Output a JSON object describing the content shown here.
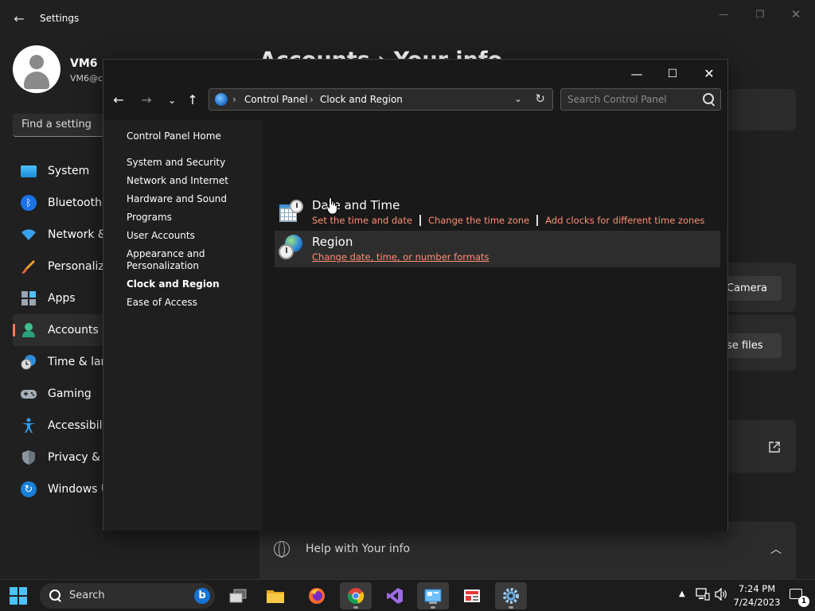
{
  "settings": {
    "window_title": "Settings",
    "user": {
      "name": "VM6",
      "email": "VM6@c"
    },
    "search_placeholder": "Find a setting",
    "nav": [
      {
        "label": "System",
        "icon": "monitor-icon"
      },
      {
        "label": "Bluetooth &",
        "icon": "bluetooth-icon"
      },
      {
        "label": "Network &",
        "icon": "wifi-icon"
      },
      {
        "label": "Personaliza",
        "icon": "brush-icon"
      },
      {
        "label": "Apps",
        "icon": "apps-icon"
      },
      {
        "label": "Accounts",
        "icon": "person-icon",
        "active": true
      },
      {
        "label": "Time & lang",
        "icon": "clock-globe-icon"
      },
      {
        "label": "Gaming",
        "icon": "gamepad-icon"
      },
      {
        "label": "Accessibilit",
        "icon": "accessibility-icon"
      },
      {
        "label": "Privacy & se",
        "icon": "shield-icon"
      },
      {
        "label": "Windows U",
        "icon": "update-icon"
      }
    ],
    "heading": "Accounts  ›  Your info",
    "camera_button": "Camera",
    "files_button": "se files",
    "help_label": "Help with Your info"
  },
  "control_panel": {
    "breadcrumb": [
      "Control Panel",
      "Clock and Region"
    ],
    "search_placeholder": "Search Control Panel",
    "sidebar": [
      "Control Panel Home",
      "System and Security",
      "Network and Internet",
      "Hardware and Sound",
      "Programs",
      "User Accounts",
      "Appearance and Personalization",
      "Clock and Region",
      "Ease of Access"
    ],
    "categories": {
      "date_time": {
        "title": "Date and Time",
        "links": [
          "Set the time and date",
          "Change the time zone",
          "Add clocks for different time zones"
        ]
      },
      "region": {
        "title": "Region",
        "links": [
          "Change date, time, or number formats"
        ]
      }
    }
  },
  "taskbar": {
    "search_label": "Search",
    "time": "7:24 PM",
    "date": "7/24/2023",
    "notification_count": "1",
    "accent_color": "#4cc2ff"
  },
  "colors": {
    "link": "#ff8f73",
    "accent": "#ff7a5c"
  }
}
